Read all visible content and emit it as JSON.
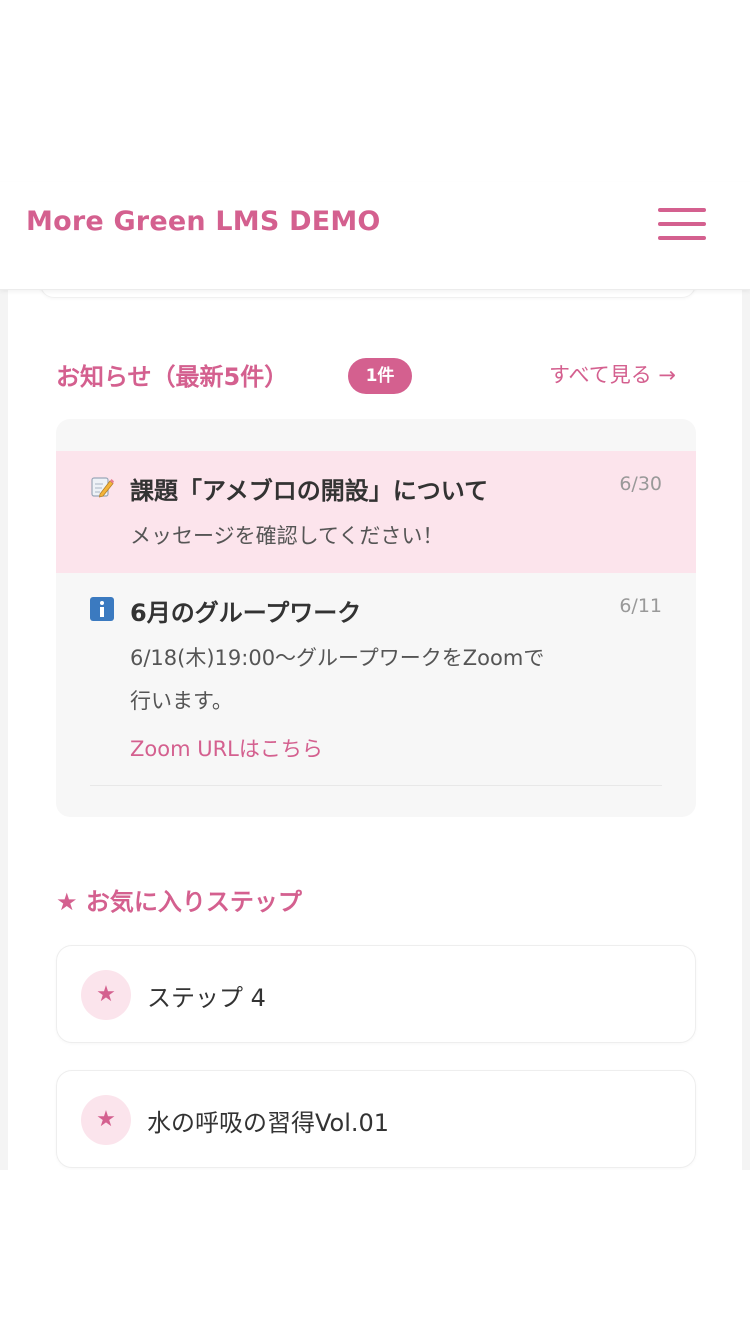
{
  "header": {
    "brand": "More Green LMS DEMO",
    "menu_icon": "hamburger-menu-icon"
  },
  "notices": {
    "title": "お知らせ（最新5件）",
    "unread_badge": "1件",
    "see_all": "すべて見る →",
    "items": [
      {
        "icon": "memo-pencil-icon",
        "title": "課題「アメブロの開設」について",
        "date": "6/30",
        "body": "メッセージを確認してください！",
        "unread": true
      },
      {
        "icon": "info-icon",
        "title": "6月のグループワーク",
        "date": "6/11",
        "body_line1": "6/18(木)19:00〜グループワークをZoomで",
        "body_line2": "行います。",
        "link": "Zoom URLはこちら",
        "unread": false
      }
    ]
  },
  "favorites": {
    "title": "★ お気に入りステップ",
    "items": [
      {
        "icon": "star-icon",
        "glyph": "★",
        "label": "ステップ 4"
      },
      {
        "icon": "star-icon",
        "glyph": "★",
        "label": "水の呼吸の習得Vol.01"
      }
    ]
  },
  "colors": {
    "accent": "#d4608f",
    "unread_bg": "#fce4ec",
    "notice_bg": "#f7f7f7"
  }
}
